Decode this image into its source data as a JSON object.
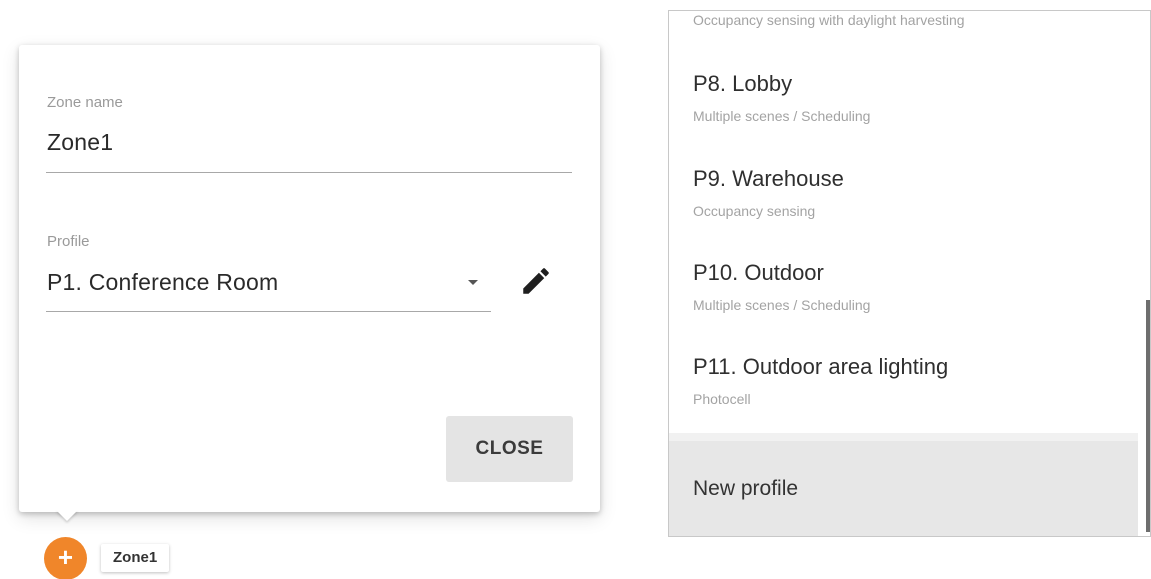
{
  "zone_dialog": {
    "zone_name_label": "Zone name",
    "zone_name_value": "Zone1",
    "profile_label": "Profile",
    "profile_value": "P1. Conference Room",
    "close_label": "CLOSE"
  },
  "zone_marker": {
    "icon": "plus-icon",
    "tag": "Zone1",
    "color": "#f0862a"
  },
  "profile_list": {
    "top_partial_subtitle": "Occupancy sensing with daylight harvesting",
    "items": [
      {
        "title": "P8. Lobby",
        "subtitle": "Multiple scenes / Scheduling"
      },
      {
        "title": "P9. Warehouse",
        "subtitle": "Occupancy sensing"
      },
      {
        "title": "P10. Outdoor",
        "subtitle": "Multiple scenes / Scheduling"
      },
      {
        "title": "P11. Outdoor area lighting",
        "subtitle": "Photocell"
      }
    ],
    "new_profile_label": "New profile"
  }
}
